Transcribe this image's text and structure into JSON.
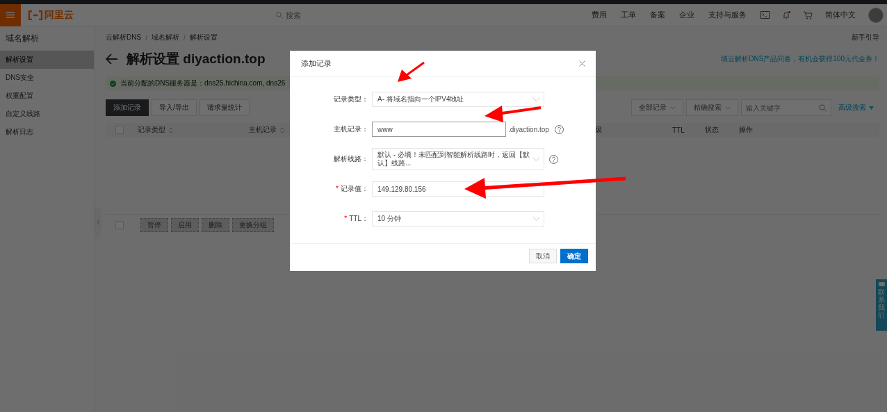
{
  "topbar": {
    "brand": "阿里云",
    "search_placeholder": "搜索",
    "nav": [
      "费用",
      "工单",
      "备案",
      "企业",
      "支持与服务"
    ],
    "language": "简体中文",
    "notification_dot": true
  },
  "sidebar": {
    "title": "域名解析",
    "items": [
      {
        "label": "解析设置",
        "selected": true
      },
      {
        "label": "DNS安全",
        "selected": false
      },
      {
        "label": "权重配置",
        "selected": false
      },
      {
        "label": "自定义线路",
        "selected": false
      },
      {
        "label": "解析日志",
        "selected": false
      }
    ]
  },
  "breadcrumb": [
    {
      "label": "云解析DNS"
    },
    {
      "separator": "/",
      "label": "域名解析"
    },
    {
      "separator": "/",
      "label": "解析设置"
    }
  ],
  "guide_link": "新手引导",
  "page_title": "解析设置 diyaction.top",
  "survey_link": "填云解析DNS产品问卷，有机会获得100元代金券！",
  "alert": "当前分配的DNS服务器是：dns25.hichina.com, dns26",
  "toolbar": {
    "buttons": [
      {
        "label": "添加记录",
        "primary": true
      },
      {
        "label": "导入/导出",
        "primary": false
      },
      {
        "label": "请求量统计",
        "primary": false
      }
    ],
    "filters": [
      "全部记录",
      "精确搜索"
    ],
    "search_placeholder": "输入关键字",
    "advanced": "高级搜索"
  },
  "table": {
    "select_all_checked": false,
    "columns": [
      {
        "label": "记录类型",
        "sortable": true
      },
      {
        "label": "主机记录",
        "sortable": true
      },
      {
        "label": "级",
        "sortable": false
      },
      {
        "label": "TTL",
        "sortable": false
      },
      {
        "label": "状态",
        "sortable": false
      },
      {
        "label": "操作",
        "sortable": false
      }
    ]
  },
  "batch_checked": false,
  "batch_buttons": [
    {
      "label": "暂停",
      "disabled": true
    },
    {
      "label": "启用",
      "disabled": true
    },
    {
      "label": "删除",
      "disabled": true
    },
    {
      "label": "更换分组",
      "disabled": true
    }
  ],
  "contact_tab": "联系我们",
  "modal": {
    "title": "添加记录",
    "fields": [
      {
        "kind": "select",
        "label": "记录类型：",
        "value": "A- 将域名指向一个IPV4地址",
        "focused": false
      },
      {
        "kind": "input",
        "label": "主机记录：",
        "value": "www",
        "suffix": ".diyaction.top",
        "help": true,
        "focused": true
      },
      {
        "kind": "select",
        "label": "解析线路：",
        "value": "默认 - 必填！未匹配到智能解析线路时，返回【默认】线路...",
        "help": true,
        "focused": false
      },
      {
        "kind": "input",
        "label": "记录值：",
        "required_mark": "*",
        "value": "149.129.80.156",
        "focused": false
      },
      {
        "kind": "select",
        "label": "TTL：",
        "required_mark": "*",
        "value": "10 分钟",
        "focused": false
      }
    ],
    "cancel": "取消",
    "confirm": "确定"
  }
}
